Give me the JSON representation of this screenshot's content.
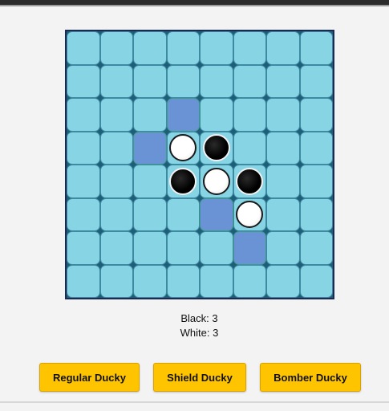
{
  "board": {
    "rows": 8,
    "cols": 8,
    "pieces": [
      {
        "row": 3,
        "col": 3,
        "color": "white"
      },
      {
        "row": 3,
        "col": 4,
        "color": "black"
      },
      {
        "row": 4,
        "col": 3,
        "color": "black"
      },
      {
        "row": 4,
        "col": 4,
        "color": "white"
      },
      {
        "row": 4,
        "col": 5,
        "color": "black"
      },
      {
        "row": 5,
        "col": 5,
        "color": "white"
      }
    ],
    "valid_moves": [
      {
        "row": 2,
        "col": 3
      },
      {
        "row": 3,
        "col": 2
      },
      {
        "row": 5,
        "col": 4
      },
      {
        "row": 6,
        "col": 5
      }
    ],
    "colors": {
      "cell": "#87d4e4",
      "hint": "#6a93d6",
      "border": "#1b2a55"
    }
  },
  "score": {
    "black_label": "Black: 3",
    "white_label": "White: 3"
  },
  "buttons": {
    "regular": "Regular Ducky",
    "shield": "Shield Ducky",
    "bomber": "Bomber Ducky",
    "color": "#ffc400"
  }
}
